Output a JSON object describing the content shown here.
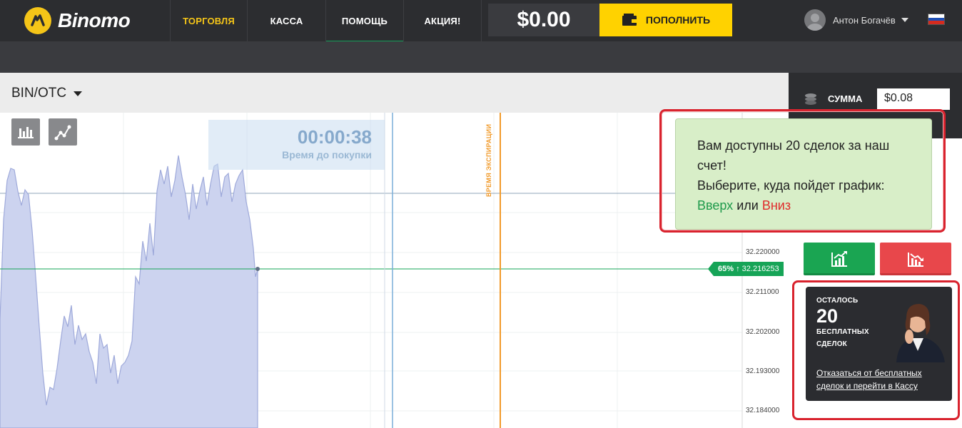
{
  "brand": {
    "name": "Binomo",
    "color": "#f5c518"
  },
  "nav": {
    "items": [
      {
        "label": "ТОРГОВЛЯ",
        "active": true
      },
      {
        "label": "КАССА"
      },
      {
        "label": "ПОМОЩЬ",
        "underlined": true
      },
      {
        "label": "АКЦИЯ!"
      }
    ]
  },
  "account": {
    "balance": "$0.00",
    "deposit_label": "ПОПОЛНИТЬ",
    "user_name": "Антон Богачёв",
    "language_flag": "russia-flag-icon"
  },
  "asset": {
    "name": "BIN/OTC"
  },
  "chart_tools": [
    "chart-type-icon",
    "indicators-icon"
  ],
  "timer": {
    "value": "00:00:38",
    "label": "Время до покупки"
  },
  "expiration_label": "ВРЕМЯ ЭКСПИРАЦИИ",
  "price_tag": {
    "payout": "65%",
    "direction": "↑",
    "price": "32.216253"
  },
  "axis_labels": [
    "32.220000",
    "32.211000",
    "32.202000",
    "32.193000",
    "32.184000"
  ],
  "amount": {
    "label": "СУММА",
    "value": "$0.08"
  },
  "tooltip": {
    "line1": "Вам доступны 20 сделок за наш счет!",
    "line2": "Выберите, куда пойдет график:",
    "up_word": "Вверх",
    "or_word": "или",
    "down_word": "Вниз"
  },
  "trade_buttons": {
    "up_icon": "chart-up-icon",
    "down_icon": "chart-down-icon"
  },
  "free_deals": {
    "remaining_label": "ОСТАЛОСЬ",
    "count": "20",
    "label_line1": "БЕСПЛАТНЫХ",
    "label_line2": "СДЕЛОК",
    "link": "Отказаться от бесплатных сделок и перейти в Кассу"
  },
  "colors": {
    "topbar": "#2c2d30",
    "accent_yellow": "#ffd200",
    "up_green": "#1aa552",
    "down_red": "#e8474b",
    "tip_bg": "#d8eec8",
    "highlight_red": "#d9232e",
    "expiration_orange": "#f19a2a"
  }
}
